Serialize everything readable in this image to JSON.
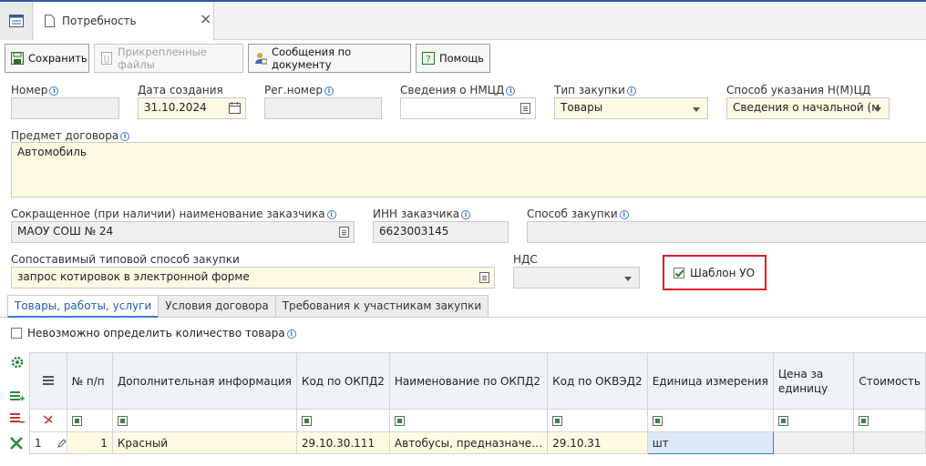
{
  "tab": {
    "title": "Потребность",
    "close": "×"
  },
  "toolbar": {
    "save": "Сохранить",
    "attachments": "Прикрепленные файлы",
    "messages": "Сообщения по документу",
    "help": "Помощь"
  },
  "fields": {
    "number": {
      "label": "Номер",
      "value": ""
    },
    "created": {
      "label": "Дата создания",
      "value": "31.10.2024"
    },
    "regnum": {
      "label": "Рег.номер",
      "value": ""
    },
    "nmcd": {
      "label": "Сведения о НМЦД",
      "value": ""
    },
    "purchase_type": {
      "label": "Тип закупки",
      "value": "Товары"
    },
    "price_method": {
      "label": "Способ указания Н(М)ЦД",
      "value": "Сведения о начальной (м"
    },
    "subject": {
      "label": "Предмет договора",
      "value": "Автомобиль"
    },
    "customer": {
      "label": "Сокращенное (при наличии) наименование заказчика",
      "value": "МАОУ СОШ № 24"
    },
    "inn": {
      "label": "ИНН заказчика",
      "value": "6623003145"
    },
    "method": {
      "label": "Способ закупки",
      "value": ""
    },
    "typical_method": {
      "label": "Сопоставимый типовой способ закупки",
      "value": "запрос котировок в электронной форме"
    },
    "vat": {
      "label": "НДС",
      "value": ""
    },
    "template": {
      "label": "Шаблон УО",
      "checked": true
    }
  },
  "tabs": [
    "Товары, работы, услуги",
    "Условия договора",
    "Требования к участникам закупки"
  ],
  "active_tab": 0,
  "qty_checkbox": {
    "label": "Невозможно определить количество товара",
    "checked": false
  },
  "grid": {
    "headers": [
      "№ п/п",
      "Дополнительная информация",
      "Код по ОКПД2",
      "Наименование по ОКПД2",
      "Код по ОКВЭД2",
      "Единица измерения",
      "Цена за единицу",
      "Стоимость"
    ],
    "rows": [
      {
        "index": "1",
        "num": "1",
        "info": "Красный",
        "okpd": "29.10.30.111",
        "okpd_name": "Автобусы, предназначе…",
        "okved": "29.10.31",
        "unit": "шт",
        "price": "",
        "cost": ""
      }
    ]
  },
  "colors": {
    "accent": "#2d5d9f",
    "highlight": "#d9201f",
    "required_bg": "#fdf9e3"
  }
}
